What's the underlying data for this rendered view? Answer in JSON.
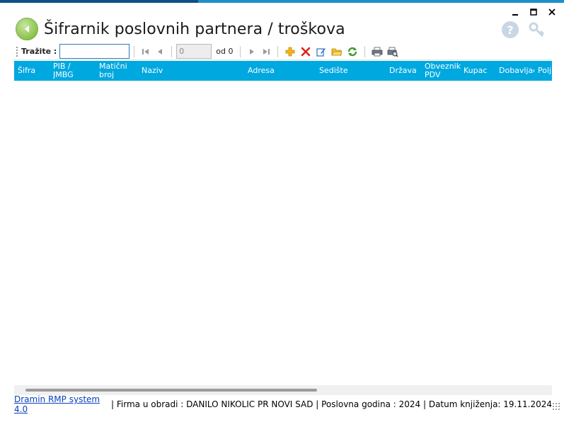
{
  "window": {
    "title": "Šifrarnik poslovnih partnera / troškova",
    "controls": {
      "minimize": "minimize-icon",
      "maximize": "maximize-icon",
      "close": "close-icon"
    }
  },
  "toolbar": {
    "search_label": "Tražite :",
    "search_value": "",
    "page_value": "0",
    "of_label": "od 0",
    "icons": [
      "first-page-icon",
      "prev-page-icon",
      "next-page-icon",
      "last-page-icon",
      "add-icon",
      "delete-icon",
      "edit-icon",
      "open-folder-icon",
      "refresh-icon",
      "print-icon",
      "print-preview-icon"
    ]
  },
  "grid": {
    "columns": [
      {
        "label": "Šifra"
      },
      {
        "label": "PIB / JMBG"
      },
      {
        "label": "Matični broj"
      },
      {
        "label": "Naziv"
      },
      {
        "label": "Adresa"
      },
      {
        "label": "Sedište"
      },
      {
        "label": "Država"
      },
      {
        "label": "Obveznik PDV"
      },
      {
        "label": "Kupac"
      },
      {
        "label": "Dobavljač"
      },
      {
        "label": "Polj"
      }
    ],
    "rows": []
  },
  "status": {
    "app_link": "Dramin RMP system 4.0",
    "info": "|  Firma u obradi : DANILO NIKOLIC PR NOVI SAD  |  Poslovna godina : 2024  |  Datum knjiženja: 19.11.2024"
  },
  "colors": {
    "accent": "#00a8e0",
    "accent_dark": "#0d4f86",
    "link": "#0a3fbd"
  }
}
